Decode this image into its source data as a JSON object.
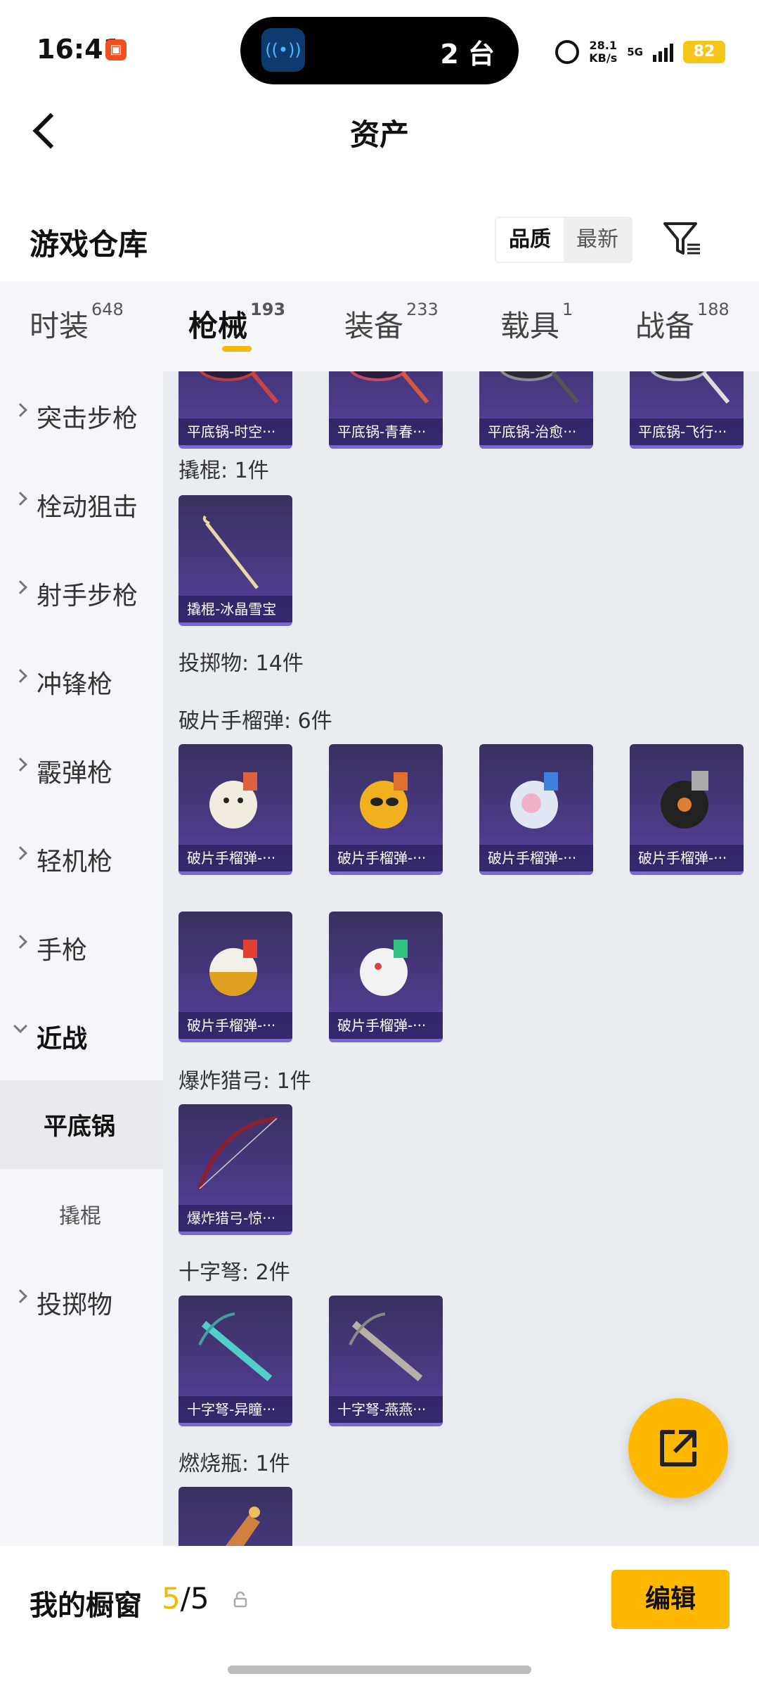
{
  "status": {
    "time": "16:41",
    "island_text": "2 台",
    "speed": "28.1",
    "speed_unit": "KB/s",
    "network": "5G",
    "battery": "82"
  },
  "header": {
    "title": "资产"
  },
  "section": {
    "title": "游戏仓库",
    "sort_quality": "品质",
    "sort_newest": "最新"
  },
  "tabs": [
    {
      "label": "时装",
      "count": "648"
    },
    {
      "label": "枪械",
      "count": "193"
    },
    {
      "label": "装备",
      "count": "233"
    },
    {
      "label": "载具",
      "count": "1"
    },
    {
      "label": "战备",
      "count": "188"
    }
  ],
  "sidebar": {
    "items": [
      {
        "label": "突击步枪"
      },
      {
        "label": "栓动狙击"
      },
      {
        "label": "射手步枪"
      },
      {
        "label": "冲锋枪"
      },
      {
        "label": "霰弹枪"
      },
      {
        "label": "轻机枪"
      },
      {
        "label": "手枪"
      },
      {
        "label": "近战"
      },
      {
        "label": "平底锅"
      },
      {
        "label": "撬棍"
      },
      {
        "label": "投掷物"
      }
    ]
  },
  "groups": {
    "pan_items": [
      {
        "label": "平底锅-时空···"
      },
      {
        "label": "平底锅-青春···"
      },
      {
        "label": "平底锅-治愈···"
      },
      {
        "label": "平底锅-飞行···"
      }
    ],
    "crowbar": {
      "title": "撬棍: 1件",
      "items": [
        {
          "label": "撬棍-冰晶雪宝"
        }
      ]
    },
    "throwables": {
      "title": "投掷物: 14件"
    },
    "frag": {
      "title": "破片手榴弹: 6件",
      "items": [
        {
          "label": "破片手榴弹-···"
        },
        {
          "label": "破片手榴弹-···"
        },
        {
          "label": "破片手榴弹-···"
        },
        {
          "label": "破片手榴弹-···"
        },
        {
          "label": "破片手榴弹-···"
        },
        {
          "label": "破片手榴弹-···"
        }
      ]
    },
    "bow": {
      "title": "爆炸猎弓: 1件",
      "items": [
        {
          "label": "爆炸猎弓-惊···"
        }
      ]
    },
    "crossbow": {
      "title": "十字弩: 2件",
      "items": [
        {
          "label": "十字弩-异瞳···"
        },
        {
          "label": "十字弩-燕燕···"
        }
      ]
    },
    "molotov": {
      "title": "燃烧瓶: 1件"
    }
  },
  "showcase": {
    "title": "我的橱窗",
    "count_current": "5",
    "count_sep_total": "/5",
    "edit_label": "编辑"
  },
  "colors": {
    "accent": "#ffb800",
    "card_bg": "#4d3b8a"
  }
}
